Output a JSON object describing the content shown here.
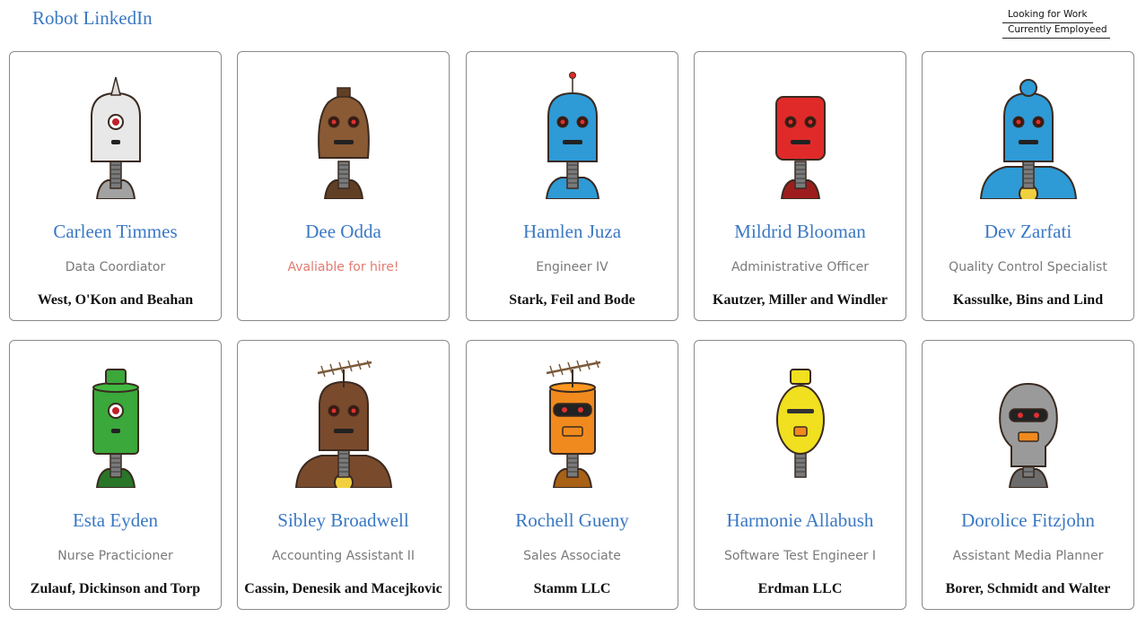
{
  "app": {
    "title": "Robot LinkedIn"
  },
  "filters": {
    "looking_for_work": "Looking for Work",
    "currently_employed": "Currently Employeed"
  },
  "robots": [
    {
      "name": "Carleen Timmes",
      "role": "Data Coordiator",
      "company": "West, O'Kon and Beahan",
      "color": "#e8e8e8"
    },
    {
      "name": "Dee Odda",
      "role": "Avaliable for hire!",
      "company": "",
      "color": "#8a5a35"
    },
    {
      "name": "Hamlen Juza",
      "role": "Engineer IV",
      "company": "Stark, Feil and Bode",
      "color": "#2e9ad6"
    },
    {
      "name": "Mildrid Blooman",
      "role": "Administrative Officer",
      "company": "Kautzer, Miller and Windler",
      "color": "#e02a2a"
    },
    {
      "name": "Dev Zarfati",
      "role": "Quality Control Specialist",
      "company": "Kassulke, Bins and Lind",
      "color": "#2e9ad6"
    },
    {
      "name": "Esta Eyden",
      "role": "Nurse Practicioner",
      "company": "Zulauf, Dickinson and Torp",
      "color": "#3aa83a"
    },
    {
      "name": "Sibley Broadwell",
      "role": "Accounting Assistant II",
      "company": "Cassin, Denesik and Macejkovic",
      "color": "#7a4a2c"
    },
    {
      "name": "Rochell Gueny",
      "role": "Sales Associate",
      "company": "Stamm LLC",
      "color": "#f08a1e"
    },
    {
      "name": "Harmonie Allabush",
      "role": "Software Test Engineer I",
      "company": "Erdman LLC",
      "color": "#f0e020"
    },
    {
      "name": "Dorolice Fitzjohn",
      "role": "Assistant Media Planner",
      "company": "Borer, Schmidt and Walter",
      "color": "#9a9a9a"
    }
  ]
}
